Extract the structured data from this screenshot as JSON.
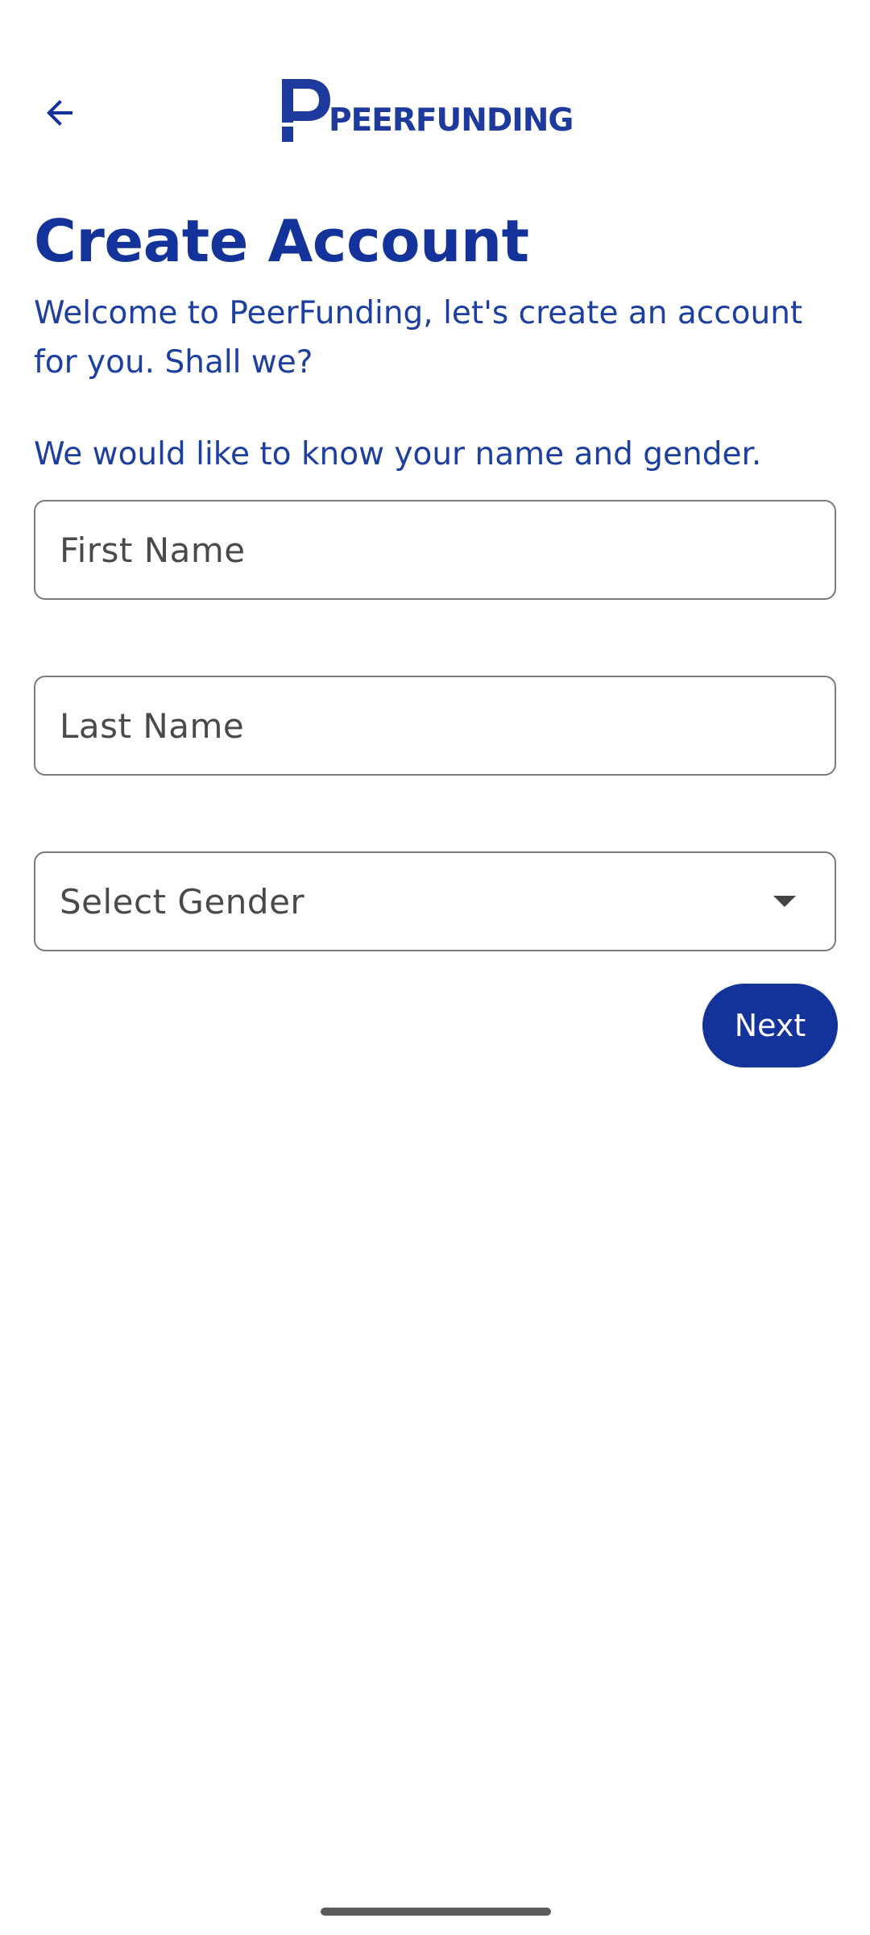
{
  "header": {
    "logo_text": "PEERFUNDING",
    "back_icon": "arrow-left-icon"
  },
  "title": "Create Account",
  "welcome": "Welcome to PeerFunding, let's create an account for you. Shall we?",
  "prompt": "We would like to know your name and gender.",
  "form": {
    "first_name_placeholder": "First Name",
    "last_name_placeholder": "Last Name",
    "gender_placeholder": "Select Gender",
    "gender_icon": "dropdown-arrow-icon"
  },
  "actions": {
    "next_label": "Next"
  },
  "colors": {
    "brand": "#14339a",
    "text_accent": "#1d3f9f",
    "border": "#7a7a7a"
  }
}
